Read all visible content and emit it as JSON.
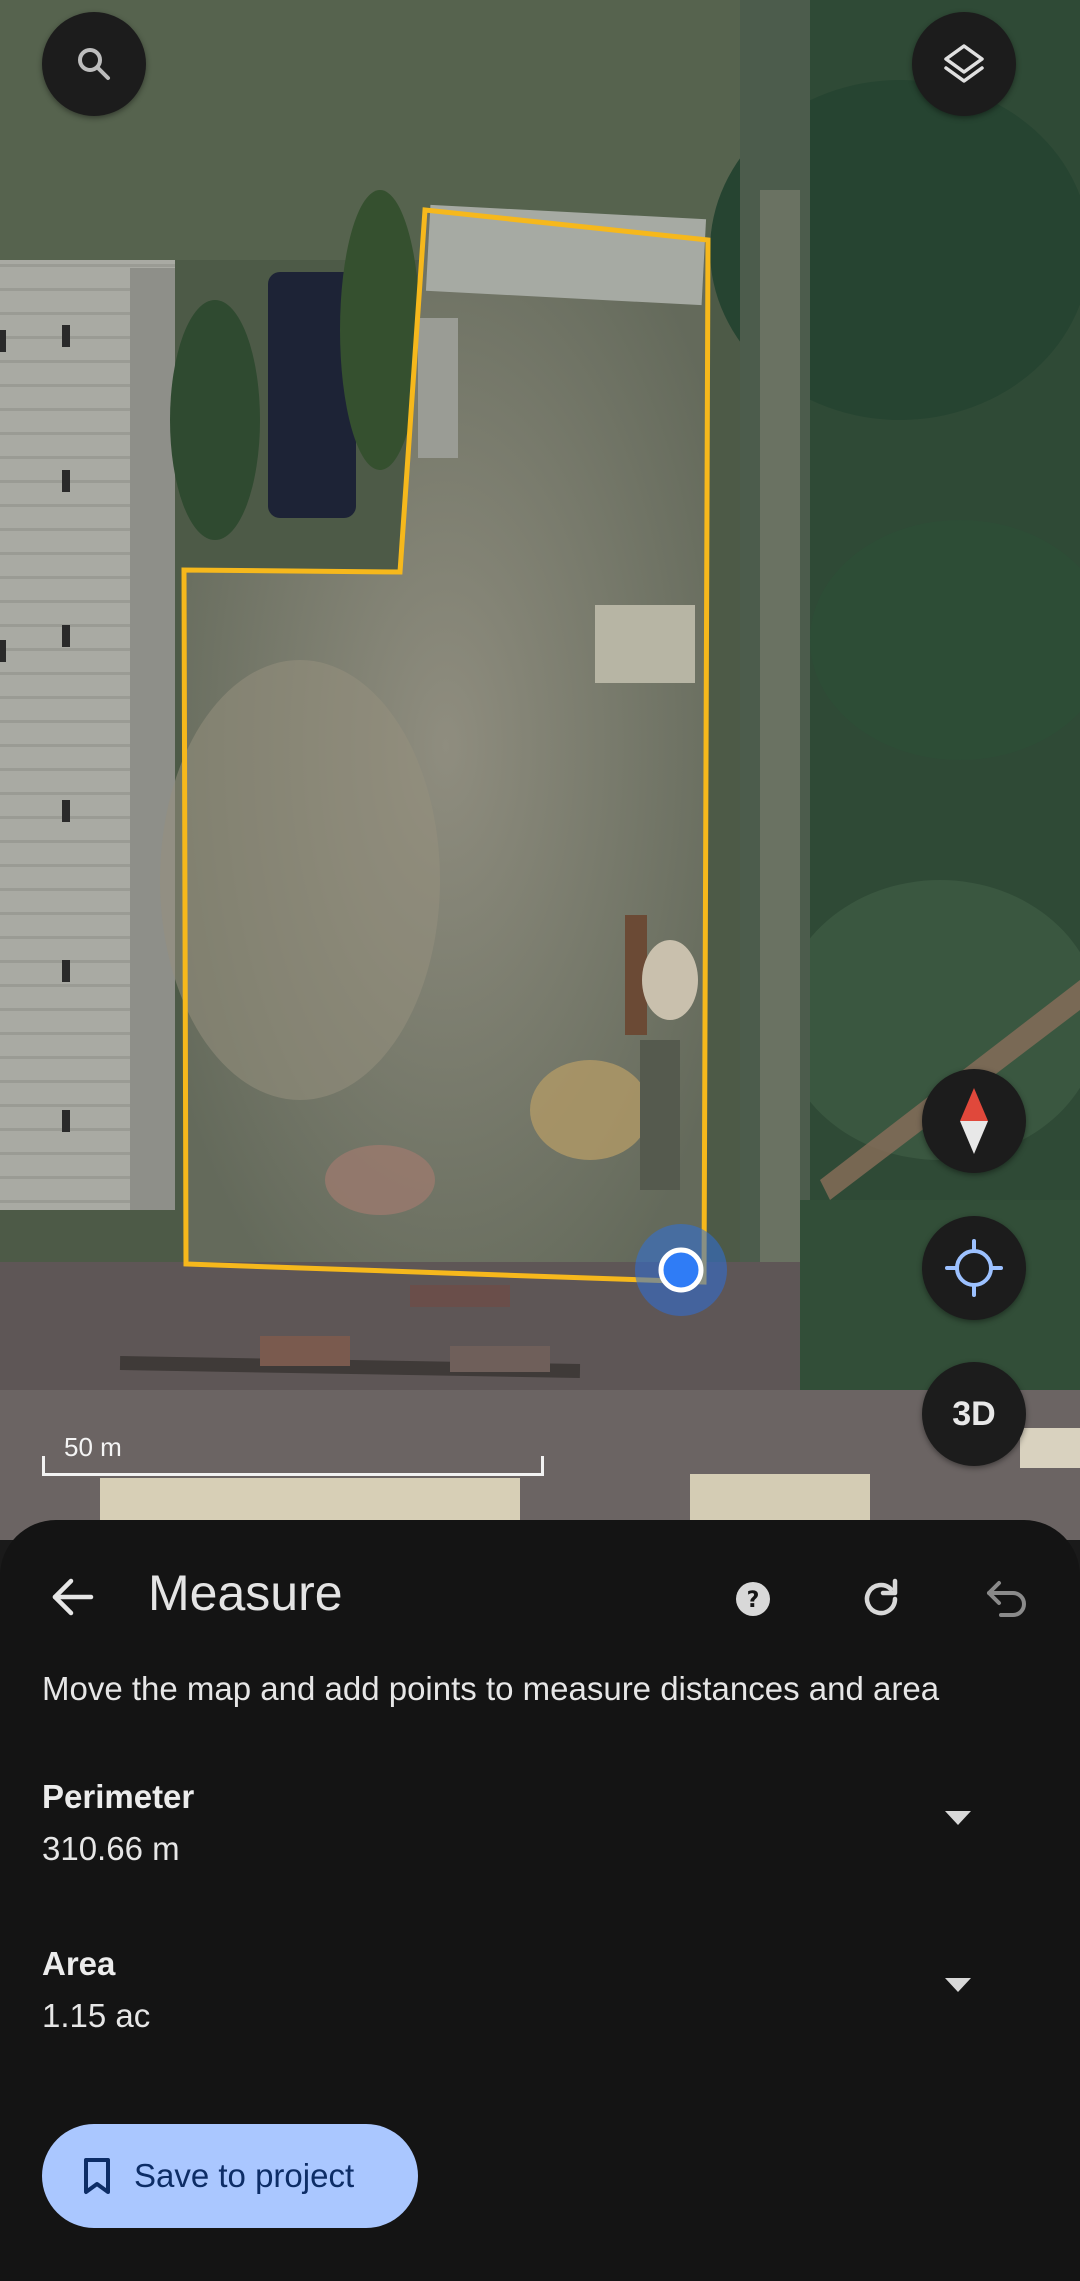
{
  "map": {
    "scale_label": "50 m",
    "accent_color": "#f6b81c",
    "location_marker_color": "#3b82f6"
  },
  "controls": {
    "search_icon": "search-icon",
    "layers_icon": "layers-icon",
    "compass_icon": "compass-icon",
    "locate_icon": "my-location-icon",
    "toggle_3d_label": "3D"
  },
  "panel": {
    "title": "Measure",
    "instructions": "Move the map and add points to measure distances and area",
    "perimeter": {
      "label": "Perimeter",
      "value": "310.66 m"
    },
    "area": {
      "label": "Area",
      "value": "1.15 ac"
    },
    "save_label": "Save to project",
    "save_button_color": "#aac7ff"
  }
}
